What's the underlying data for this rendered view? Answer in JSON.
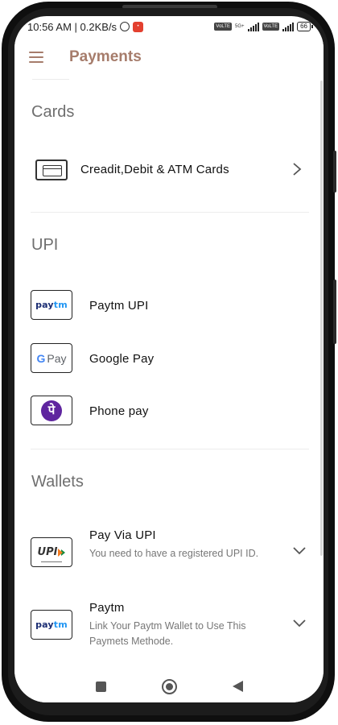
{
  "status_bar": {
    "time_text": "10:56 AM | 0.2KB/s",
    "network_tag_1": "VoLTE",
    "network_tag_2": "5G+",
    "network_tag_3": "VoLTE",
    "battery": "66"
  },
  "app_bar": {
    "title": "Payments",
    "menu_icon": "hamburger-menu-icon"
  },
  "colors": {
    "accent": "#a67c6b",
    "section_title": "#6f6f6f",
    "paytm_dark": "#1b2d73",
    "paytm_light": "#2196f3",
    "phonepe_purple": "#5f259f"
  },
  "sections": {
    "cards": {
      "title": "Cards",
      "items": [
        {
          "label": "Creadit,Debit & ATM Cards",
          "icon": "credit-card-icon",
          "action_icon": "chevron-right-icon"
        }
      ]
    },
    "upi": {
      "title": "UPI",
      "items": [
        {
          "label": "Paytm UPI",
          "logo": "paytm-logo",
          "logo_text_a": "pay",
          "logo_text_b": "tm"
        },
        {
          "label": "Google Pay",
          "logo": "google-pay-logo",
          "logo_text_a": "G",
          "logo_text_b": "Pay"
        },
        {
          "label": "Phone pay",
          "logo": "phonepe-logo",
          "logo_text_a": "पे"
        }
      ]
    },
    "wallets": {
      "title": "Wallets",
      "items": [
        {
          "label": "Pay Via UPI",
          "sub": "You need to have a registered UPI ID.",
          "logo": "upi-logo",
          "logo_text": "UPI",
          "action_icon": "chevron-down-icon"
        },
        {
          "label": "Paytm",
          "sub": "Link Your Paytm Wallet to Use This Paymets Methode.",
          "logo": "paytm-logo",
          "logo_text_a": "pay",
          "logo_text_b": "tm",
          "action_icon": "chevron-down-icon"
        }
      ]
    }
  },
  "nav_bar": {
    "recents": "square-recents-icon",
    "home": "circle-home-icon",
    "back": "triangle-back-icon"
  }
}
